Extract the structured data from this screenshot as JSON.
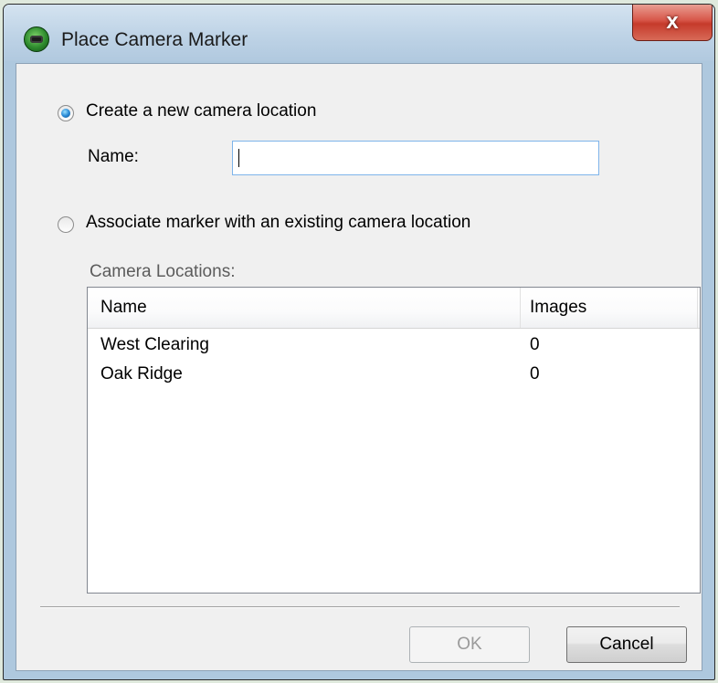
{
  "window": {
    "title": "Place Camera Marker",
    "close_glyph": "x"
  },
  "options": {
    "create_new": {
      "label": "Create a new camera location",
      "selected": true
    },
    "name_label": "Name:",
    "name_value": "",
    "associate_existing": {
      "label": "Associate marker with an existing camera location",
      "selected": false
    }
  },
  "locations": {
    "group_label": "Camera Locations:",
    "columns": [
      "Name",
      "Images"
    ],
    "rows": [
      {
        "name": "West Clearing",
        "images": "0"
      },
      {
        "name": "Oak Ridge",
        "images": "0"
      }
    ]
  },
  "buttons": {
    "ok": {
      "label": "OK",
      "enabled": false
    },
    "cancel": {
      "label": "Cancel",
      "enabled": true
    }
  },
  "colors": {
    "accent_radio": "#2a8bd6",
    "close_button": "#c53a2b",
    "input_border": "#7eb4ea"
  }
}
